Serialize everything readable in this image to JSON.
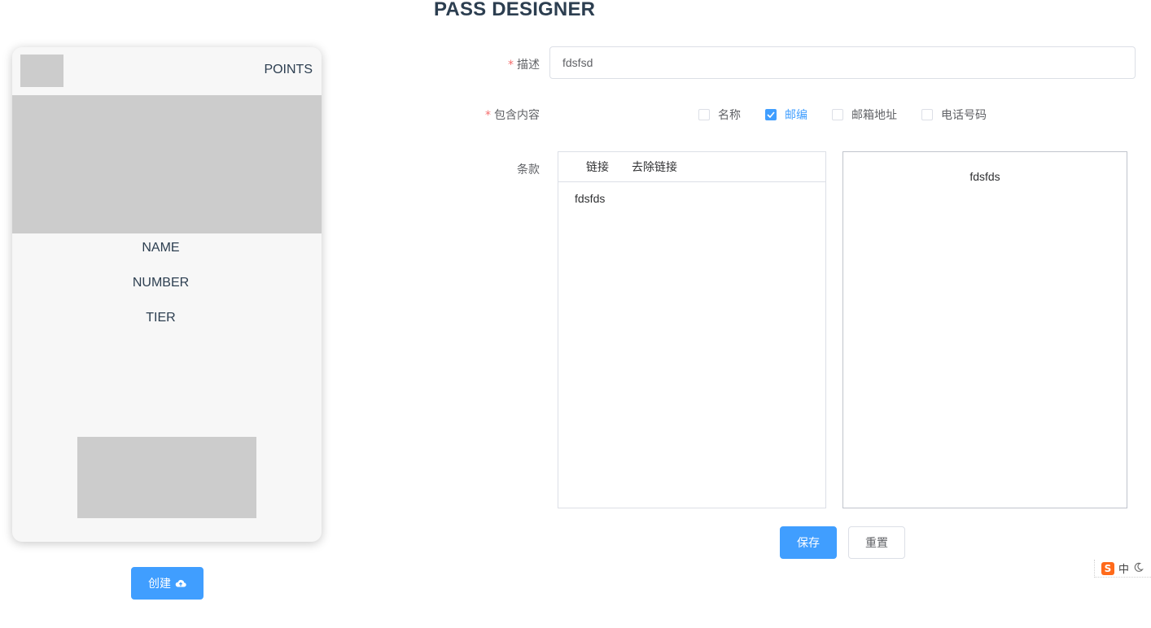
{
  "page": {
    "title": "PASS DESIGNER"
  },
  "pass": {
    "points_label": "POINTS",
    "fields": [
      "NAME",
      "NUMBER",
      "TIER"
    ],
    "placeholder_color": "#cccccc"
  },
  "create_button": {
    "label": "创建",
    "icon": "cloud-upload-icon"
  },
  "form": {
    "description": {
      "label": "描述",
      "required": true,
      "value": "fdsfsd"
    },
    "contents": {
      "label": "包含内容",
      "required": true,
      "options": [
        {
          "label": "名称",
          "checked": false
        },
        {
          "label": "邮编",
          "checked": true
        },
        {
          "label": "邮箱地址",
          "checked": false
        },
        {
          "label": "电话号码",
          "checked": false
        }
      ]
    },
    "terms": {
      "label": "条款",
      "toolbar": [
        "链接",
        "去除链接"
      ],
      "editor_text": "fdsfds",
      "preview_text": "fdsfds"
    },
    "buttons": {
      "save": "保存",
      "reset": "重置"
    }
  },
  "ime": {
    "logo": "S",
    "mode": "中",
    "icon": "moon-icon"
  },
  "colors": {
    "primary": "#409eff",
    "required": "#f56c6c",
    "ime_orange": "#ff6a1a"
  }
}
